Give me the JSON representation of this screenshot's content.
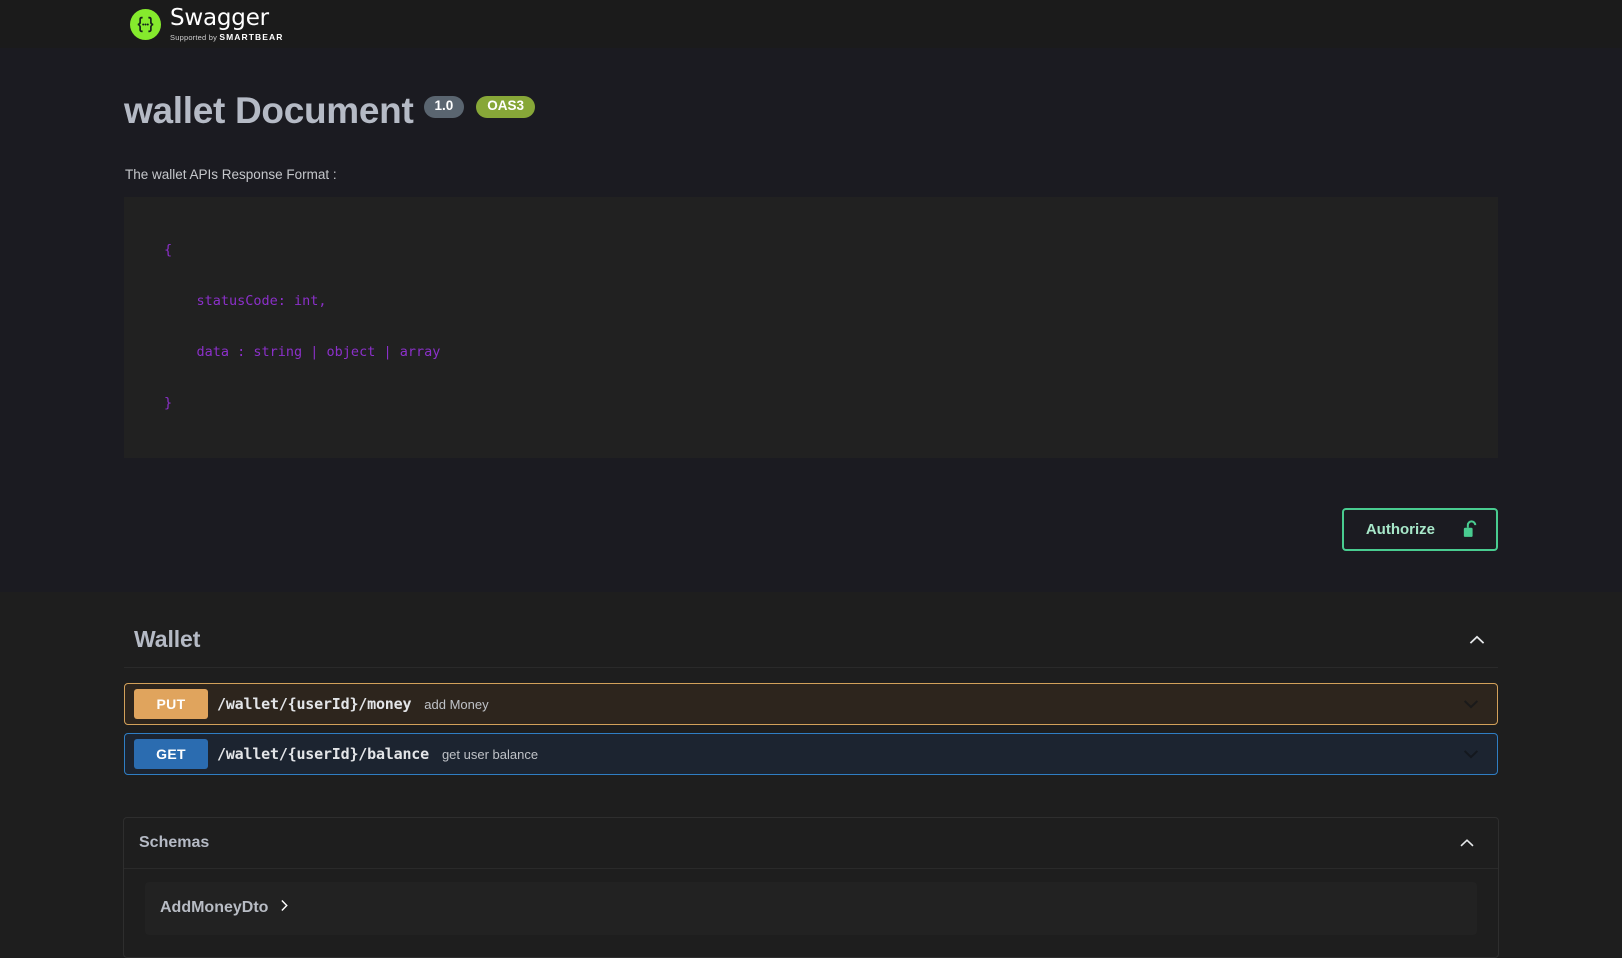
{
  "topbar": {
    "logo_word": "Swagger",
    "logo_trademark": "™",
    "logo_supported_prefix": "Supported by",
    "logo_supported_brand": "SMARTBEAR",
    "logo_icon": "swagger-braces-icon"
  },
  "info": {
    "title": "wallet Document",
    "version_badge": "1.0",
    "oas_badge": "OAS3",
    "description": "The wallet APIs Response Format :",
    "code_lines": [
      "{",
      "    statusCode: int,",
      "    data : string | object | array",
      "}"
    ]
  },
  "auth": {
    "button_label": "Authorize",
    "lock_icon": "unlocked-padlock-icon"
  },
  "tag": {
    "name": "Wallet",
    "collapse_icon": "chevron-up-icon",
    "operations": [
      {
        "method": "PUT",
        "path": "/wallet/{userId}/money",
        "summary": "add Money",
        "expand_icon": "chevron-down-icon"
      },
      {
        "method": "GET",
        "path": "/wallet/{userId}/balance",
        "summary": "get user balance",
        "expand_icon": "chevron-down-icon"
      }
    ]
  },
  "schemas": {
    "title": "Schemas",
    "collapse_icon": "chevron-up-icon",
    "models": [
      {
        "name": "AddMoneyDto",
        "expand_icon": "chevron-right-icon"
      }
    ]
  },
  "colors": {
    "page_background": "#1e1e1e",
    "info_background": "#1b1b21",
    "topbar_background": "#1b1b1b",
    "swagger_green": "#85ea2d",
    "authorize_green": "#49cc90",
    "put_orange": "#e0a45d",
    "get_blue": "#2b6cb0",
    "oas_badge_green": "#87a738",
    "version_badge_gray": "#5a6570",
    "code_purple": "#8b30c9"
  }
}
